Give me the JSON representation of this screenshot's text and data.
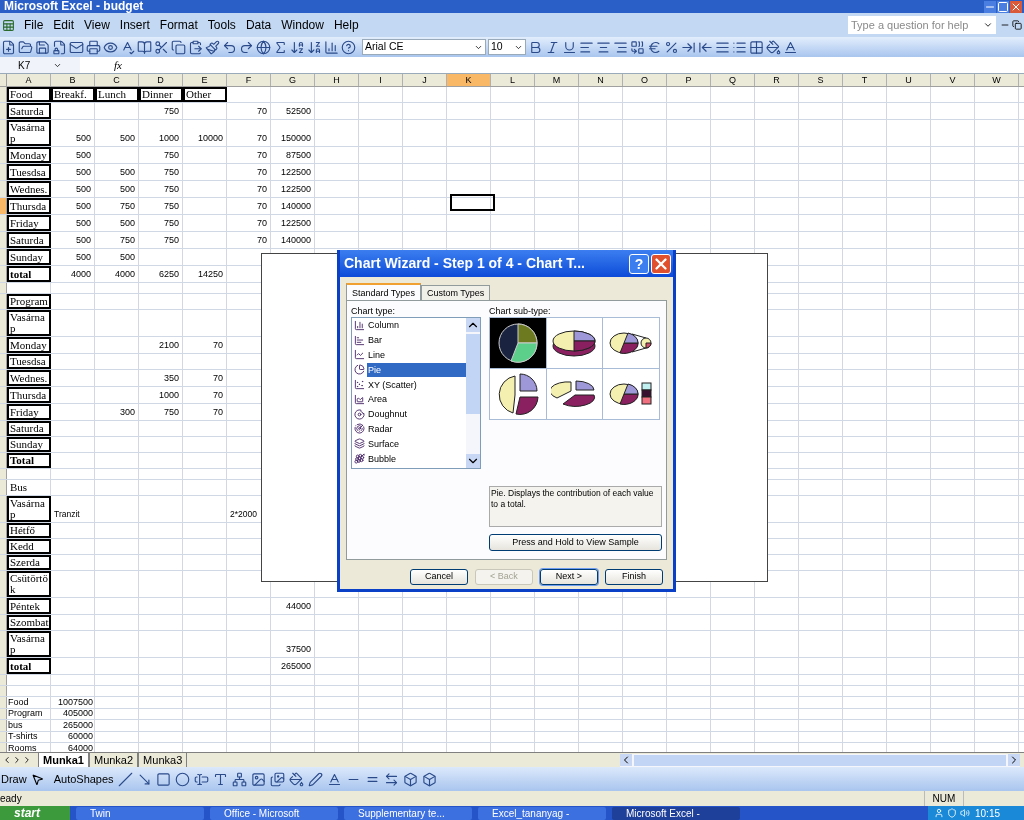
{
  "window": {
    "title": "Microsoft Excel - budget"
  },
  "menu": [
    "File",
    "Edit",
    "View",
    "Insert",
    "Format",
    "Tools",
    "Data",
    "Window",
    "Help"
  ],
  "help_box": {
    "placeholder": "Type a question for help"
  },
  "font_box": {
    "value": "Arial CE"
  },
  "size_box": {
    "value": "10"
  },
  "name_box": {
    "value": "K7"
  },
  "formula_label": "fx",
  "columns": [
    {
      "label": "A",
      "selected": false
    },
    {
      "label": "B",
      "selected": false
    },
    {
      "label": "C",
      "selected": false
    },
    {
      "label": "D",
      "selected": false
    },
    {
      "label": "E",
      "selected": false
    },
    {
      "label": "F",
      "selected": false
    },
    {
      "label": "G",
      "selected": false
    },
    {
      "label": "H",
      "selected": false
    },
    {
      "label": "I",
      "selected": false
    },
    {
      "label": "J",
      "selected": false
    },
    {
      "label": "K",
      "selected": true
    },
    {
      "label": "L",
      "selected": false
    },
    {
      "label": "M",
      "selected": false
    },
    {
      "label": "N",
      "selected": false
    },
    {
      "label": "O",
      "selected": false
    },
    {
      "label": "P",
      "selected": false
    },
    {
      "label": "Q",
      "selected": false
    },
    {
      "label": "R",
      "selected": false
    },
    {
      "label": "S",
      "selected": false
    },
    {
      "label": "T",
      "selected": false
    },
    {
      "label": "U",
      "selected": false
    },
    {
      "label": "V",
      "selected": false
    },
    {
      "label": "W",
      "selected": false
    }
  ],
  "rows": [
    {
      "kind": "entry",
      "framed": true,
      "bold": false,
      "selected": false,
      "label": "Food",
      "heads": {
        "B": "Breakf.",
        "C": "Lunch",
        "D": "Dinner",
        "E": "Other"
      }
    },
    {
      "kind": "entry",
      "framed": true,
      "bold": false,
      "selected": false,
      "label": "Saturda",
      "values": {
        "D": "750",
        "F": "70",
        "G": "52500"
      }
    },
    {
      "kind": "entry",
      "framed": true,
      "bold": false,
      "selected": false,
      "label": "Vasárnap",
      "values": {
        "B": "500",
        "C": "500",
        "D": "1000",
        "E": "10000",
        "F": "70",
        "G": "150000"
      }
    },
    {
      "kind": "entry",
      "framed": true,
      "bold": false,
      "selected": false,
      "label": "Monday",
      "values": {
        "B": "500",
        "D": "750",
        "F": "70",
        "G": "87500"
      }
    },
    {
      "kind": "entry",
      "framed": true,
      "bold": false,
      "selected": false,
      "label": "Tuesdsa",
      "values": {
        "B": "500",
        "C": "500",
        "D": "750",
        "F": "70",
        "G": "122500"
      }
    },
    {
      "kind": "entry",
      "framed": true,
      "bold": false,
      "selected": false,
      "label": "Wednes.",
      "values": {
        "B": "500",
        "C": "500",
        "D": "750",
        "F": "70",
        "G": "122500"
      }
    },
    {
      "kind": "entry",
      "framed": true,
      "bold": false,
      "selected": true,
      "label": "Thursda",
      "values": {
        "B": "500",
        "C": "750",
        "D": "750",
        "F": "70",
        "G": "140000"
      }
    },
    {
      "kind": "entry",
      "framed": true,
      "bold": false,
      "selected": false,
      "label": "Friday",
      "values": {
        "B": "500",
        "C": "500",
        "D": "750",
        "F": "70",
        "G": "122500"
      }
    },
    {
      "kind": "entry",
      "framed": true,
      "bold": false,
      "selected": false,
      "label": "Saturda",
      "values": {
        "B": "500",
        "C": "750",
        "D": "750",
        "F": "70",
        "G": "140000"
      }
    },
    {
      "kind": "entry",
      "framed": true,
      "bold": false,
      "selected": false,
      "label": "Sunday",
      "values": {
        "B": "500",
        "C": "500"
      }
    },
    {
      "kind": "entry",
      "framed": true,
      "bold": true,
      "selected": false,
      "label": "total",
      "values": {
        "B": "4000",
        "C": "4000",
        "D": "6250",
        "E": "14250"
      }
    },
    {
      "kind": "entry",
      "selected": false
    },
    {
      "kind": "entry",
      "framed": true,
      "bold": false,
      "selected": false,
      "label": "Program"
    },
    {
      "kind": "entry",
      "framed": true,
      "bold": false,
      "selected": false,
      "label": "Vasárnap"
    },
    {
      "kind": "entry",
      "framed": true,
      "bold": false,
      "selected": false,
      "label": "Monday",
      "values": {
        "D": "2100",
        "E": "70"
      }
    },
    {
      "kind": "entry",
      "framed": true,
      "bold": false,
      "selected": false,
      "label": "Tuesdsa"
    },
    {
      "kind": "entry",
      "framed": true,
      "bold": false,
      "selected": false,
      "label": "Wednes.",
      "values": {
        "D": "350",
        "E": "70"
      }
    },
    {
      "kind": "entry",
      "framed": true,
      "bold": false,
      "selected": false,
      "label": "Thursda",
      "values": {
        "D": "1000",
        "E": "70"
      }
    },
    {
      "kind": "entry",
      "framed": true,
      "bold": false,
      "selected": false,
      "label": "Friday",
      "values": {
        "C": "300",
        "D": "750",
        "E": "70"
      }
    },
    {
      "kind": "entry",
      "framed": true,
      "bold": false,
      "selected": false,
      "label": "Saturda"
    },
    {
      "kind": "entry",
      "framed": true,
      "bold": false,
      "selected": false,
      "label": "Sunday"
    },
    {
      "kind": "entry",
      "framed": true,
      "bold": true,
      "selected": false,
      "label": "Total"
    },
    {
      "kind": "entry",
      "selected": false
    },
    {
      "kind": "entry",
      "framed": false,
      "bold": false,
      "selected": false,
      "label": "Bus"
    },
    {
      "kind": "entry",
      "framed": true,
      "bold": false,
      "selected": false,
      "label": "Vasárnap",
      "notes": {
        "B": "Tranzit",
        "F": "2*2000"
      }
    },
    {
      "kind": "entry",
      "framed": true,
      "bold": false,
      "selected": false,
      "label": "Hétfő"
    },
    {
      "kind": "entry",
      "framed": true,
      "bold": false,
      "selected": false,
      "label": "Kedd"
    },
    {
      "kind": "entry",
      "framed": true,
      "bold": false,
      "selected": false,
      "label": "Szerda"
    },
    {
      "kind": "entry",
      "framed": true,
      "bold": false,
      "selected": false,
      "label": "Csütörtök"
    },
    {
      "kind": "entry",
      "framed": true,
      "bold": false,
      "selected": false,
      "label": "Péntek",
      "values": {
        "G": "44000"
      }
    },
    {
      "kind": "entry",
      "framed": true,
      "bold": false,
      "selected": false,
      "label": "Szombat"
    },
    {
      "kind": "entry",
      "framed": true,
      "bold": false,
      "selected": false,
      "label": "Vasárnap",
      "values": {
        "G": "37500"
      }
    },
    {
      "kind": "entry",
      "framed": true,
      "bold": true,
      "selected": false,
      "label": "total",
      "values": {
        "G": "265000"
      }
    },
    {
      "kind": "entry",
      "selected": false
    },
    {
      "kind": "entry",
      "selected": false
    },
    {
      "kind": "summary",
      "selected": false,
      "label": "Food",
      "values": {
        "B": "1007500"
      }
    },
    {
      "kind": "summary",
      "selected": false,
      "label": "Program",
      "values": {
        "B": "405000"
      }
    },
    {
      "kind": "summary",
      "selected": false,
      "label": "bus",
      "values": {
        "B": "265000"
      }
    },
    {
      "kind": "summary",
      "selected": false,
      "label": "T-shirts",
      "values": {
        "B": "60000"
      }
    },
    {
      "kind": "summary",
      "selected": false,
      "label": "Rooms",
      "values": {
        "B": "64000"
      }
    }
  ],
  "sheet_tabs": [
    {
      "label": "Munka1",
      "selected": true
    },
    {
      "label": "Munka2",
      "selected": false
    },
    {
      "label": "Munka3",
      "selected": false
    }
  ],
  "drawing_toolbar": {
    "draw": "Draw",
    "autoshapes": "AutoShapes"
  },
  "status_bar": {
    "text": "eady",
    "num": "NUM"
  },
  "taskbar": {
    "start": "start",
    "buttons": [
      {
        "label": "Twin",
        "selected": false
      },
      {
        "label": "Office - Microsoft",
        "selected": false
      },
      {
        "label": "Supplementary te...",
        "selected": false
      },
      {
        "label": "Excel_tananyag -",
        "selected": false
      },
      {
        "label": "Microsoft Excel -",
        "selected": true
      }
    ],
    "clock": "10:15"
  },
  "dialog": {
    "title": "Chart Wizard - Step 1 of 4 - Chart T...",
    "help": "?",
    "tabs": [
      {
        "label": "Standard Types",
        "selected": true
      },
      {
        "label": "Custom Types",
        "selected": false
      }
    ],
    "chart_type_label": "Chart type:",
    "chart_types": [
      {
        "label": "Column",
        "selected": false
      },
      {
        "label": "Bar",
        "selected": false
      },
      {
        "label": "Line",
        "selected": false
      },
      {
        "label": "Pie",
        "selected": true
      },
      {
        "label": "XY (Scatter)",
        "selected": false
      },
      {
        "label": "Area",
        "selected": false
      },
      {
        "label": "Doughnut",
        "selected": false
      },
      {
        "label": "Radar",
        "selected": false
      },
      {
        "label": "Surface",
        "selected": false
      },
      {
        "label": "Bubble",
        "selected": false
      }
    ],
    "subtype_label": "Chart sub-type:",
    "subtypes": [
      {
        "selected": true
      },
      {
        "selected": false
      },
      {
        "selected": false
      },
      {
        "selected": false
      },
      {
        "selected": false
      },
      {
        "selected": false
      }
    ],
    "description": "Pie. Displays the contribution of each value to a total.",
    "sample_button": "Press and Hold to View Sample",
    "buttons": [
      {
        "label": "Cancel",
        "disabled": false,
        "default": false
      },
      {
        "label": "< Back",
        "disabled": true,
        "default": false
      },
      {
        "label": "Next >",
        "disabled": false,
        "default": true
      },
      {
        "label": "Finish",
        "disabled": false,
        "default": false
      }
    ]
  }
}
